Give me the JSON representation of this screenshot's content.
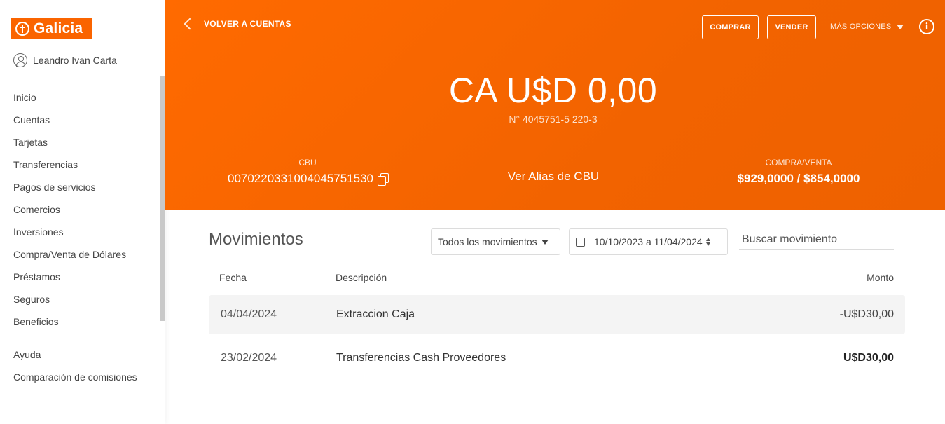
{
  "brand": {
    "name": "Galicia",
    "accent": "#fa6400"
  },
  "user": {
    "name": "Leandro Ivan Carta"
  },
  "sidebar": {
    "items": [
      {
        "label": "Inicio"
      },
      {
        "label": "Cuentas"
      },
      {
        "label": "Tarjetas"
      },
      {
        "label": "Transferencias"
      },
      {
        "label": "Pagos de servicios"
      },
      {
        "label": "Comercios"
      },
      {
        "label": "Inversiones"
      },
      {
        "label": "Compra/Venta de Dólares"
      },
      {
        "label": "Préstamos"
      },
      {
        "label": "Seguros"
      },
      {
        "label": "Beneficios"
      }
    ],
    "secondary": [
      {
        "label": "Ayuda"
      },
      {
        "label": "Comparación de comisiones"
      }
    ]
  },
  "header": {
    "back_label": "VOLVER A CUENTAS",
    "buy_label": "COMPRAR",
    "sell_label": "VENDER",
    "more_label": "MÁS OPCIONES",
    "info_icon": "info-icon",
    "balance": "CA U$D 0,00",
    "account_number": "N° 4045751-5 220-3",
    "cbu_label": "CBU",
    "cbu_value": "0070220331004045751530",
    "alias_link": "Ver Alias de CBU",
    "rate_label": "COMPRA/VENTA",
    "rate_value": "$929,0000 / $854,0000"
  },
  "movements": {
    "title": "Movimientos",
    "filter_value": "Todos los movimientos",
    "date_range": "10/10/2023 a 11/04/2024",
    "search_placeholder": "Buscar movimiento",
    "columns": {
      "date": "Fecha",
      "description": "Descripción",
      "amount": "Monto"
    },
    "rows": [
      {
        "date": "04/04/2024",
        "description": "Extraccion Caja",
        "amount": "-U$D30,00"
      },
      {
        "date": "23/02/2024",
        "description": "Transferencias Cash Proveedores",
        "amount": "U$D30,00"
      }
    ]
  }
}
